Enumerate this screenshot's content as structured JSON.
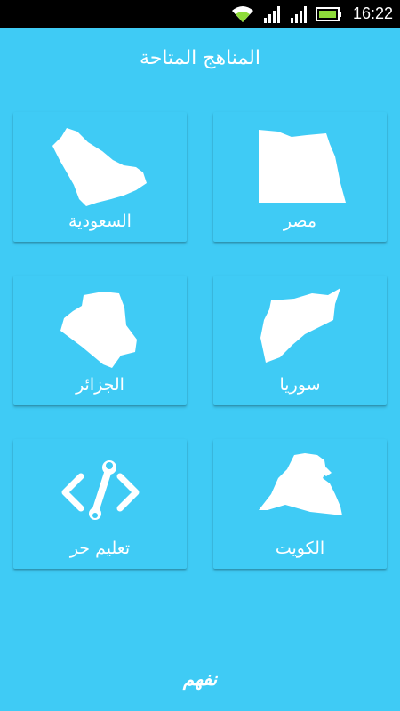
{
  "status_bar": {
    "time": "16:22",
    "icons": [
      "wifi-icon",
      "signal-icon",
      "signal-icon",
      "battery-icon"
    ]
  },
  "header": {
    "title": "المناهج المتاحة"
  },
  "curricula": [
    {
      "label": "مصر",
      "icon": "egypt-map-icon"
    },
    {
      "label": "السعودية",
      "icon": "saudi-arabia-map-icon"
    },
    {
      "label": "سوريا",
      "icon": "syria-map-icon"
    },
    {
      "label": "الجزائر",
      "icon": "algeria-map-icon"
    },
    {
      "label": "الكويت",
      "icon": "kuwait-map-icon"
    },
    {
      "label": "تعليم حر",
      "icon": "code-wrench-icon"
    }
  ],
  "footer": {
    "logo_text": "نفهم"
  },
  "colors": {
    "background": "#3fcbf5",
    "status_bar": "#000000",
    "text": "#ffffff"
  }
}
